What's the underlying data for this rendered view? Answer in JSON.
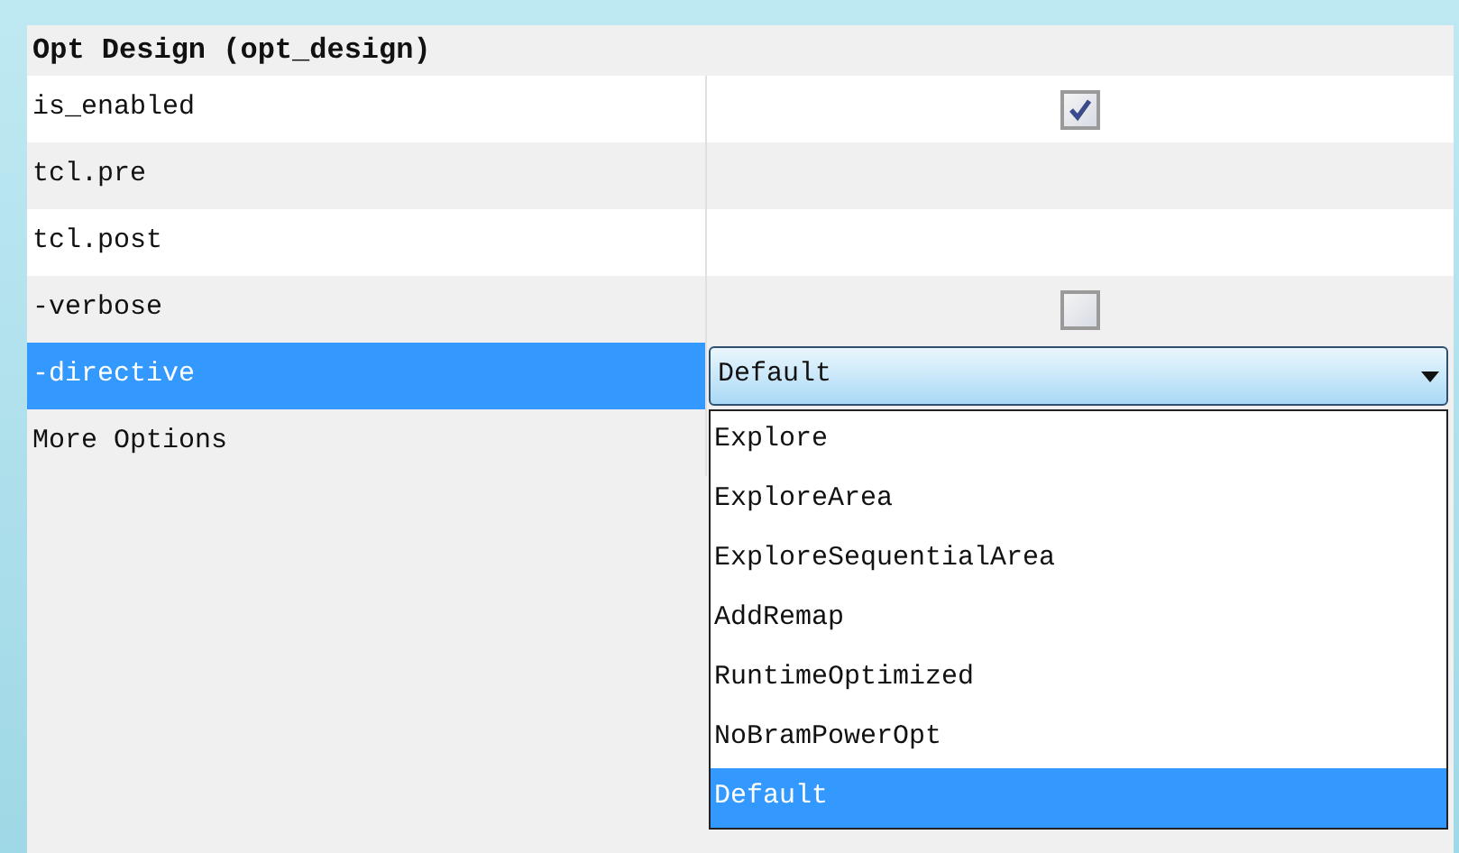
{
  "title": "Opt Design (opt_design)",
  "rows": [
    {
      "name": "is_enabled",
      "kind": "checkbox",
      "checked": true,
      "selected": false
    },
    {
      "name": "tcl.pre",
      "kind": "text",
      "selected": false
    },
    {
      "name": "tcl.post",
      "kind": "text",
      "selected": false
    },
    {
      "name": "-verbose",
      "kind": "checkbox",
      "checked": false,
      "selected": false
    },
    {
      "name": "-directive",
      "kind": "dropdown",
      "value": "Default",
      "selected": true
    },
    {
      "name": "More Options",
      "kind": "section",
      "selected": false
    }
  ],
  "dropdown_options": [
    {
      "label": "Explore",
      "selected": false
    },
    {
      "label": "ExploreArea",
      "selected": false
    },
    {
      "label": "ExploreSequentialArea",
      "selected": false
    },
    {
      "label": "AddRemap",
      "selected": false
    },
    {
      "label": "RuntimeOptimized",
      "selected": false
    },
    {
      "label": "NoBramPowerOpt",
      "selected": false
    },
    {
      "label": "Default",
      "selected": true
    }
  ]
}
